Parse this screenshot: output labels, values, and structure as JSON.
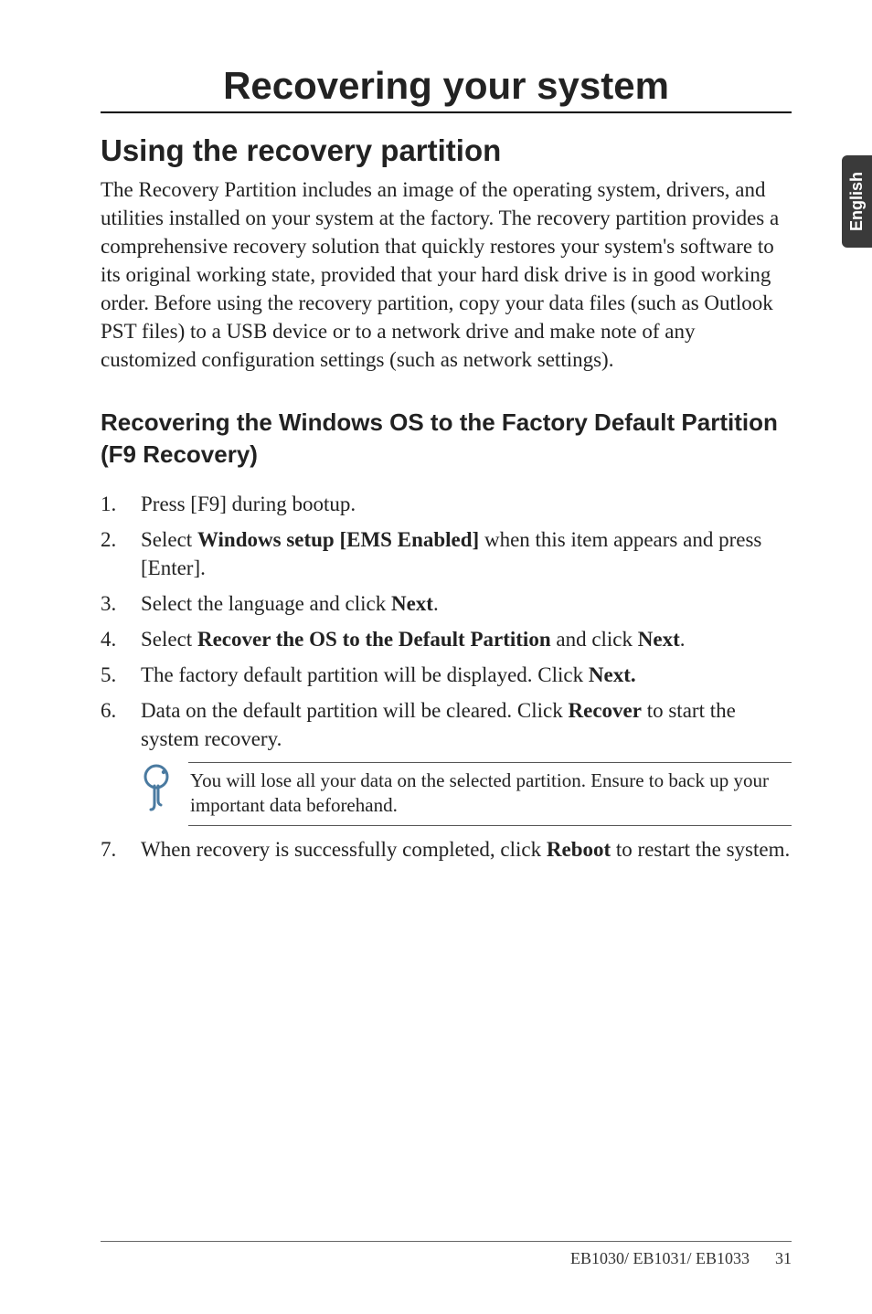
{
  "side_tab": "English",
  "chapter": {
    "title": "Recovering your system"
  },
  "section": {
    "title": "Using the recovery partition",
    "body": "The Recovery Partition includes an image of the operating system, drivers, and utilities installed on your system at the factory. The recovery partition provides a comprehensive recovery solution that quickly restores your system's software to its original working state, provided that your hard disk drive is in good working order. Before using the recovery partition, copy your data files (such as Outlook PST files) to a USB device or to a network drive and make note of any customized configuration settings (such as network settings)."
  },
  "subsection": {
    "title": "Recovering the Windows OS to the Factory Default Partition (F9 Recovery)"
  },
  "steps": {
    "s1": "Press [F9] during bootup.",
    "s2_a": "Select ",
    "s2_b": "Windows setup [EMS Enabled]",
    "s2_c": " when this item appears and press [Enter].",
    "s3_a": "Select the language and click ",
    "s3_b": "Next",
    "s3_c": ".",
    "s4_a": "Select ",
    "s4_b": "Recover the OS to the Default Partition",
    "s4_c": " and click ",
    "s4_d": "Next",
    "s4_e": ".",
    "s5_a": "The factory default partition will be displayed. Click ",
    "s5_b": "Next.",
    "s6_a": "Data on the default partition will be cleared. Click ",
    "s6_b": "Recover",
    "s6_c": " to start the system recovery.",
    "s7_a": "When recovery is successfully completed, click ",
    "s7_b": "Reboot",
    "s7_c": " to restart the system."
  },
  "note": {
    "text": "You will lose all your data on the selected partition. Ensure to back up your important data beforehand."
  },
  "footer": {
    "model": "EB1030/ EB1031/ EB1033",
    "page": "31"
  }
}
